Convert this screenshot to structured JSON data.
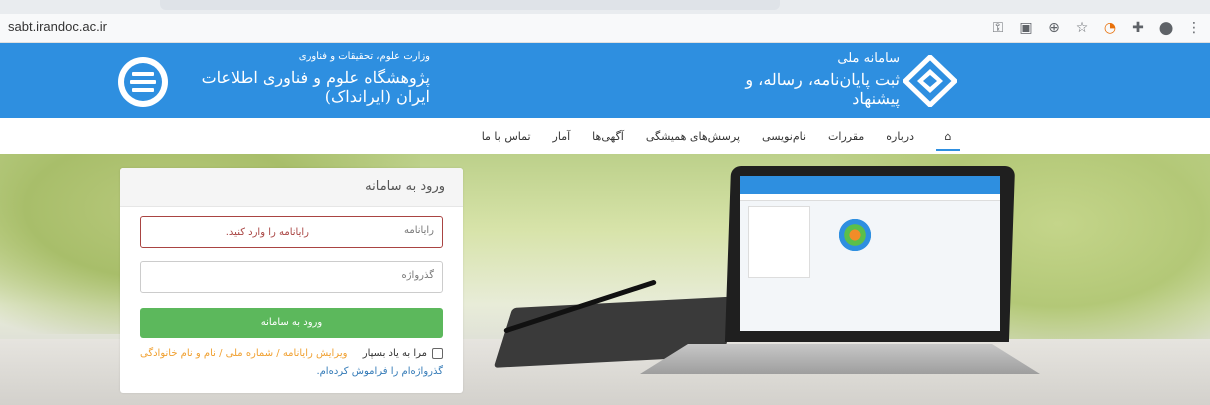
{
  "browser": {
    "url": "sabt.irandoc.ac.ir"
  },
  "header": {
    "system_small": "سامانه ملی",
    "system_title": "ثبت پایان‌نامه، رساله، و پیشنهاد",
    "ministry": "وزارت علوم، تحقیقات و فناوری",
    "institute": "پژوهشگاه علوم و فناوری اطلاعات ایران (ایرانداک)"
  },
  "nav": {
    "items": [
      "درباره",
      "مقررات",
      "نام‌نویسی",
      "پرسش‌های همیشگی",
      "آگهی‌ها",
      "آمار",
      "تماس با ما"
    ]
  },
  "login": {
    "title": "ورود به سامانه",
    "username_label": "رایانامه",
    "username_error_placeholder": "رایانامه را وارد کنید.",
    "password_label": "گذرواژه",
    "submit_label": "ورود به سامانه",
    "remember_label": "مرا به یاد بسپار",
    "edit_link": "ویرایش رایانامه / شماره ملی / نام و نام خانوادگی",
    "forgot_link": "گذرواژه‌ام را فراموش کرده‌ام."
  },
  "colors": {
    "header_blue": "#2e8fe0",
    "submit_green": "#5cb85c",
    "error_red": "#a94442",
    "link_orange": "#f0a030",
    "link_blue": "#337ab7"
  },
  "icons": [
    "key-icon",
    "translate-icon",
    "zoom-icon",
    "star-icon",
    "extension-color-icon",
    "puzzle-icon",
    "profile-icon",
    "more-icon",
    "home-icon"
  ]
}
